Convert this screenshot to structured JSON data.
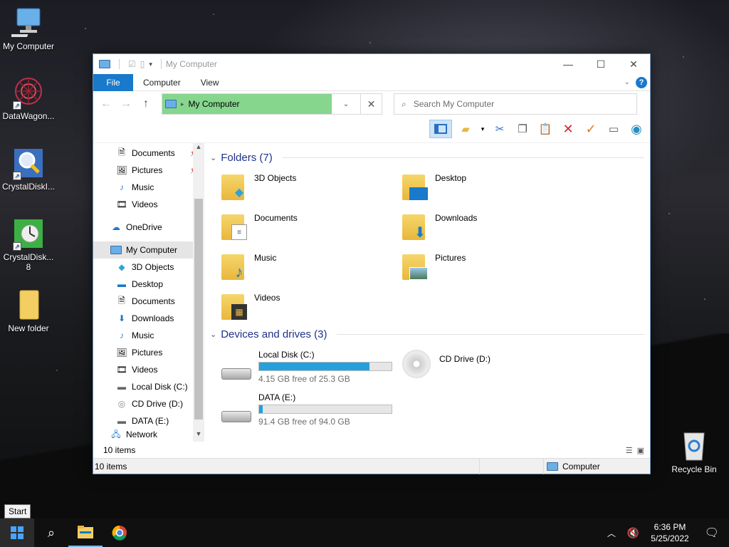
{
  "desktop": {
    "icons": [
      {
        "label": "My Computer"
      },
      {
        "label": "DataWagon..."
      },
      {
        "label": "CrystalDiskI..."
      },
      {
        "label": "CrystalDisk...",
        "label2": "8"
      },
      {
        "label": "New folder"
      },
      {
        "label": "Recycle Bin"
      }
    ]
  },
  "window": {
    "title": "My Computer",
    "ribbon_tabs": [
      "File",
      "Computer",
      "View"
    ],
    "address": "My Computer",
    "search_placeholder": "Search My Computer",
    "toolbar_icons": [
      "panes-icon",
      "new-folder-icon",
      "cut-icon",
      "copy-icon",
      "paste-icon",
      "delete-icon",
      "check-icon",
      "rename-icon",
      "globe-icon"
    ]
  },
  "nav": {
    "items": [
      {
        "label": "Documents",
        "pinned": true
      },
      {
        "label": "Pictures",
        "pinned": true
      },
      {
        "label": "Music"
      },
      {
        "label": "Videos"
      },
      {
        "label": "OneDrive"
      },
      {
        "label": "My Computer",
        "selected": true
      },
      {
        "label": "3D Objects"
      },
      {
        "label": "Desktop"
      },
      {
        "label": "Documents"
      },
      {
        "label": "Downloads"
      },
      {
        "label": "Music"
      },
      {
        "label": "Pictures"
      },
      {
        "label": "Videos"
      },
      {
        "label": "Local Disk (C:)"
      },
      {
        "label": "CD Drive (D:)"
      },
      {
        "label": "DATA (E:)"
      },
      {
        "label": "Network"
      }
    ]
  },
  "folders": {
    "header": "Folders (7)",
    "items": [
      "3D Objects",
      "Desktop",
      "Documents",
      "Downloads",
      "Music",
      "Pictures",
      "Videos"
    ]
  },
  "drives": {
    "header": "Devices and drives (3)",
    "items": [
      {
        "name": "Local Disk (C:)",
        "free": "4.15 GB free of 25.3 GB",
        "used_fraction": 0.836
      },
      {
        "name": "CD Drive (D:)"
      },
      {
        "name": "DATA (E:)",
        "free": "91.4 GB free of 94.0 GB",
        "used_fraction": 0.028
      }
    ]
  },
  "status": {
    "items_inner": "10 items",
    "items_outer": "10 items",
    "location": "Computer"
  },
  "taskbar": {
    "tooltip": "Start",
    "time": "6:36 PM",
    "date": "5/25/2022"
  },
  "colors": {
    "accent": "#1979ca",
    "address_highlight": "#86d68e",
    "drive_bar": "#26a0da",
    "group_header": "#1e3287"
  }
}
